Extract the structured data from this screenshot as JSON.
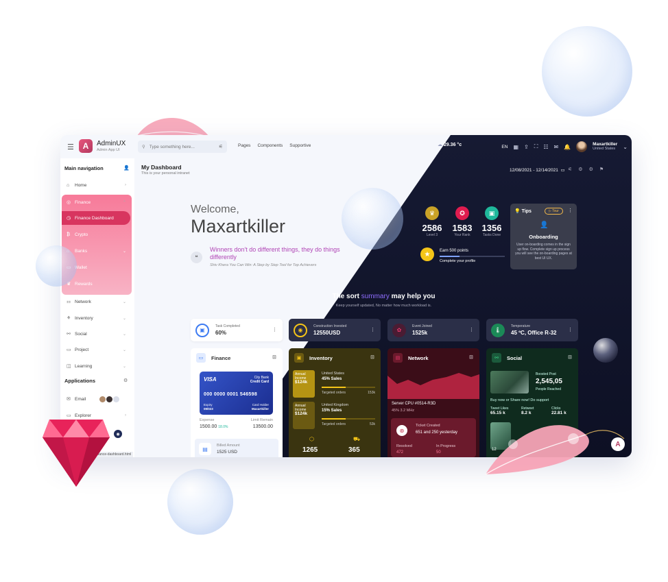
{
  "header": {
    "brand": "AdminUX",
    "brand_sub": "Admin App UI",
    "search_placeholder": "Type something here...",
    "menu": [
      "Pages",
      "Components",
      "Supportive"
    ],
    "weather": "29.36 °c",
    "lang": "EN",
    "user_name": "Maxartkiller",
    "user_location": "United States"
  },
  "sidebar": {
    "title": "Main navigation",
    "items": [
      {
        "label": "Home",
        "icon": "home-icon"
      },
      {
        "label": "Finance",
        "icon": "finance-icon"
      },
      {
        "label": "Finance Dashboard",
        "icon": "dashboard-icon"
      },
      {
        "label": "Crypto",
        "icon": "bitcoin-icon"
      },
      {
        "label": "Banks",
        "icon": "bank-icon"
      },
      {
        "label": "Wallet",
        "icon": "wallet-icon"
      },
      {
        "label": "Rewards",
        "icon": "reward-icon"
      },
      {
        "label": "Network",
        "icon": "network-icon"
      },
      {
        "label": "Inventory",
        "icon": "inventory-icon"
      },
      {
        "label": "Social",
        "icon": "social-icon"
      },
      {
        "label": "Project",
        "icon": "project-icon"
      },
      {
        "label": "Learning",
        "icon": "learning-icon"
      }
    ],
    "apps_title": "Applications",
    "apps": [
      {
        "label": "Email",
        "icon": "email-icon"
      },
      {
        "label": "Explorer",
        "icon": "explorer-icon"
      }
    ],
    "status_url": "finance-dashboard.html"
  },
  "page": {
    "title": "My Dashboard",
    "subtitle": "This is your personal intranet",
    "daterange": "12/08/2021 - 12/14/2021"
  },
  "welcome": {
    "greeting": "Welcome,",
    "name": "Maxartkiller",
    "quote": "Winners don't do different things, they do things differently",
    "author": "Shiv Khera You Can Win: A Step by Step Tool for Top Achievers"
  },
  "stats": [
    {
      "value": "2586",
      "label": "Level 3",
      "color": "#c9a227"
    },
    {
      "value": "1583",
      "label": "Your Rank",
      "color": "#e01c4f"
    },
    {
      "value": "1356",
      "label": "Tasks Done",
      "color": "#1fb89b"
    }
  ],
  "earn": {
    "title": "Earn 500 points",
    "sub": "Complete your profile",
    "progress": 0.3
  },
  "tips": {
    "title": "Tips",
    "tour": "Tour",
    "heading": "Onboarding",
    "text": "User on-boarding comes in the sign up flow. Complete sign up process you will see the on-boarding pages at best UI UX."
  },
  "summary": {
    "title_a": "The sort",
    "title_hl": "summary",
    "title_b": "may help you",
    "sub": "Keep yourself updated, No matter how much workload is."
  },
  "kpis": [
    {
      "label": "Task Completed",
      "value": "60%"
    },
    {
      "label": "Construction Invested",
      "value": "12550USD"
    },
    {
      "label": "Event Joined",
      "value": "1525k"
    },
    {
      "label": "Temperature",
      "value": "45 ºC, Office R-32"
    }
  ],
  "finance": {
    "title": "Finance",
    "card_brand": "VISA",
    "card_bank": "City Bank",
    "card_type": "Credit Card",
    "card_number": "000 0000 0001 546598",
    "expiry_label": "Expiry",
    "expiry": "09/023",
    "holder_label": "Card Holder",
    "holder": "Maxartkiller",
    "expense_label": "Expense",
    "expense": "1500.00",
    "expense_change": "18.0%",
    "limit_label": "Limit Remain",
    "limit": "13500.00",
    "billed_label": "Billed Amount",
    "billed": "1525 USD"
  },
  "inventory": {
    "title": "Inventory",
    "rows": [
      {
        "badge_label": "Annual Income",
        "badge_value": "$124k",
        "region": "United States",
        "sales": "45% Sales",
        "orders_label": "Targeted orders",
        "orders": "153k"
      },
      {
        "badge_label": "Annual Income",
        "badge_value": "$124k",
        "region": "United Kingdom",
        "sales": "15% Sales",
        "orders_label": "Targeted orders",
        "orders": "53k"
      }
    ],
    "total_a": "1265",
    "total_b": "365"
  },
  "network": {
    "title": "Network",
    "server": "Server CPU #0514-R3D",
    "server_sub": "45% 3.2 MHz",
    "ticket_title": "Ticket Created",
    "ticket_sub": "651 and 250 yesterday",
    "resolved_label": "Resolved",
    "resolved_value": "472",
    "progress_label": "In Progress",
    "progress_value": "50"
  },
  "social": {
    "title": "Social",
    "boosted_label": "Boosted Post",
    "boosted_value": "2,545,05",
    "boosted_sub": "People Reached",
    "buy_text": "Buy now or Share now! Do support",
    "metrics": [
      {
        "label": "Tweet Likes",
        "value": "65.15 k"
      },
      {
        "label": "Retweet",
        "value": "8.2 k"
      },
      {
        "label": "Clicks",
        "value": "22.81 k"
      }
    ],
    "bottom_value": "12"
  },
  "colors": {
    "accent_pink": "#f77a99",
    "dark_bg": "#12162d",
    "summary_highlight": "#8f6dff",
    "inventory_bg": "#2f2a10",
    "network_bg": "#3b0d18",
    "social_bg": "#0f2b1e"
  }
}
